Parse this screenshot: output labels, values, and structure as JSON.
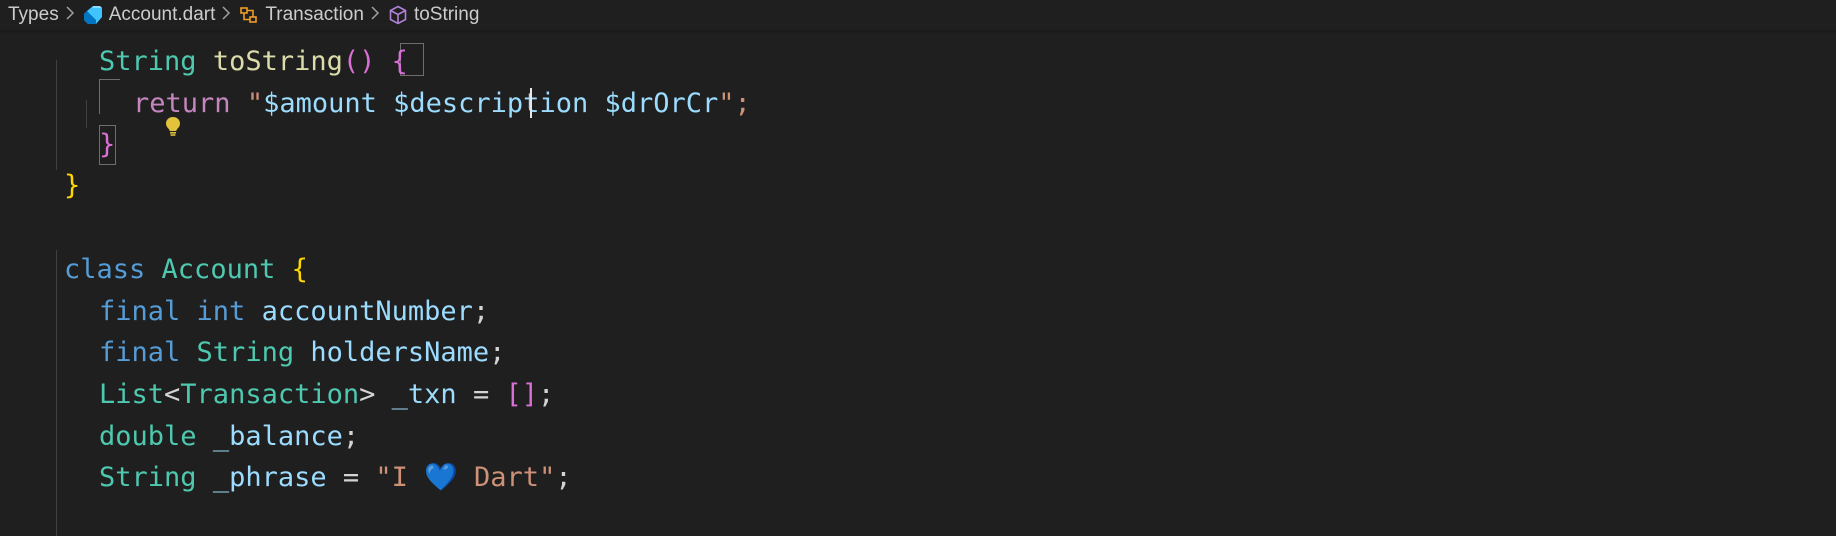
{
  "breadcrumb": {
    "items": [
      {
        "label": "Types",
        "icon": "folder"
      },
      {
        "label": "Account.dart",
        "icon": "dart-file-icon"
      },
      {
        "label": "Transaction",
        "icon": "class-icon"
      },
      {
        "label": "toString",
        "icon": "method-icon"
      }
    ],
    "separator": ">"
  },
  "code": {
    "line1": {
      "kw": "String",
      "fn": "toString",
      "parens": "()",
      "brace": "{"
    },
    "line2": {
      "ret": "return",
      "open_quote": "\"",
      "s1": "$amount",
      "s2": "$description",
      "s3": "$drOrCr",
      "close": "\";"
    },
    "line3": {
      "brace": "}"
    },
    "line4": {
      "brace": "}"
    },
    "line5": {
      "kw": "class",
      "name": "Account",
      "brace": "{"
    },
    "line6": {
      "kw": "final",
      "type": "int",
      "name": "accountNumber",
      "end": ";"
    },
    "line7": {
      "kw": "final",
      "type": "String",
      "name": "holdersName",
      "end": ";"
    },
    "line8": {
      "type": "List",
      "lt": "<",
      "generic": "Transaction",
      "gt": ">",
      "name": "_txn",
      "eq": "=",
      "br": "[]",
      "end": ";"
    },
    "line9": {
      "type": "double",
      "name": "_balance",
      "end": ";"
    },
    "line10": {
      "type": "String",
      "name": "_phrase",
      "eq": "=",
      "str": "\"I 💙 Dart\"",
      "end": ";"
    }
  },
  "colors": {
    "background": "#1f1f1f",
    "keyword": "#569cd6",
    "type": "#4ec9b0",
    "function": "#dcdcaa",
    "variable": "#9cdcfe",
    "string": "#ce9178",
    "bracket_gold": "#ffd700",
    "bracket_orchid": "#da70d6",
    "control": "#c586c0"
  }
}
